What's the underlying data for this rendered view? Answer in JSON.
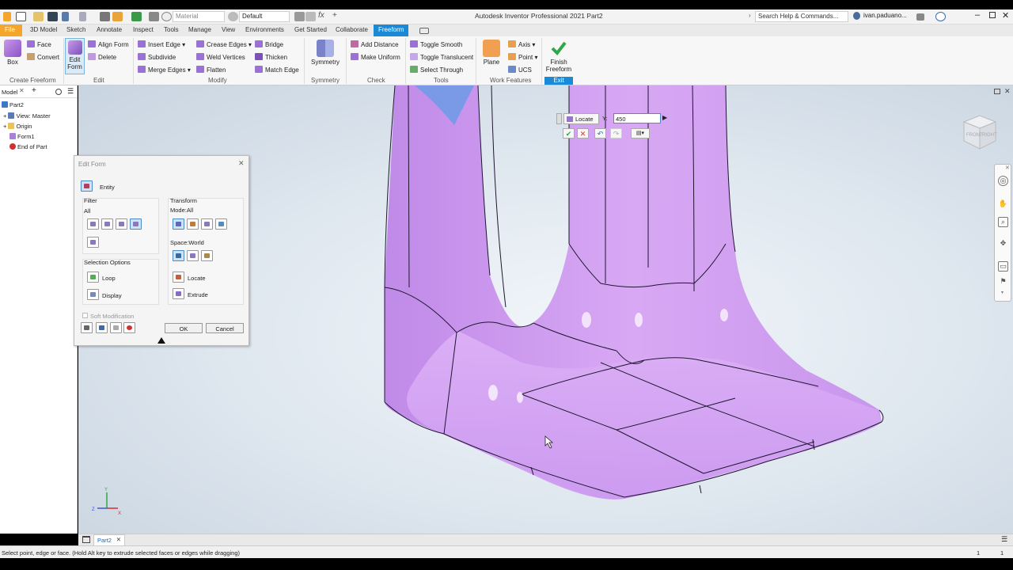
{
  "app": {
    "title": "Autodesk Inventor Professional 2021   Part2"
  },
  "quick_access": {
    "material": "Material",
    "appearance": "Default",
    "fx": "fx"
  },
  "help": {
    "search": "Search Help & Commands...",
    "user": "ivan.paduano..."
  },
  "tabs": [
    "File",
    "3D Model",
    "Sketch",
    "Annotate",
    "Inspect",
    "Tools",
    "Manage",
    "View",
    "Environments",
    "Get Started",
    "Collaborate",
    "Freeform"
  ],
  "ribbon": {
    "create_freeform": {
      "label": "Create Freeform",
      "box": "Box",
      "face": "Face",
      "convert": "Convert"
    },
    "edit": {
      "label": "Edit",
      "edit_form": "Edit Form",
      "align_form": "Align Form",
      "delete": "Delete"
    },
    "modify": {
      "label": "Modify",
      "insert_edge": "Insert Edge",
      "subdivide": "Subdivide",
      "merge_edges": "Merge Edges",
      "crease_edges": "Crease Edges",
      "weld_vertices": "Weld Vertices",
      "flatten": "Flatten",
      "bridge": "Bridge",
      "thicken": "Thicken",
      "match_edge": "Match Edge"
    },
    "symmetry": {
      "label": "Symmetry",
      "button": "Symmetry"
    },
    "check": {
      "label": "Check",
      "add_distance": "Add Distance",
      "make_uniform": "Make Uniform"
    },
    "tools": {
      "label": "Tools",
      "toggle_smooth": "Toggle Smooth",
      "toggle_translucent": "Toggle Translucent",
      "select_through": "Select Through"
    },
    "work_features": {
      "label": "Work Features",
      "plane": "Plane",
      "axis": "Axis",
      "point": "Point",
      "ucs": "UCS"
    },
    "exit": {
      "label": "Exit",
      "finish": "Finish Freeform"
    }
  },
  "browser": {
    "header": "Model",
    "items": [
      "Part2",
      "View: Master",
      "Origin",
      "Form1",
      "End of Part"
    ]
  },
  "dialog": {
    "title": "Edit Form",
    "entity": "Entity",
    "filter": "Filter",
    "filter_value": "All",
    "transform": "Transform",
    "mode": "Mode:All",
    "space": "Space:World",
    "selection_options": "Selection Options",
    "loop": "Loop",
    "display": "Display",
    "locate": "Locate",
    "extrude": "Extrude",
    "soft_modification": "Soft Modification",
    "ok": "OK",
    "cancel": "Cancel"
  },
  "minitoolbar": {
    "mode": "Locate",
    "axis": "Y:",
    "value": "450"
  },
  "viewcube": {
    "front": "FRONT",
    "right": "RIGHT"
  },
  "doc_tab": "Part2",
  "status": {
    "message": "Select point, edge or face. (Hold Alt key to extrude selected faces or edges while dragging)",
    "n1": "1",
    "n2": "1"
  },
  "colors": {
    "accent": "#1a8ad6",
    "file_tab": "#f3a62a",
    "form": "#d7a8f3",
    "form_edge": "#1a1a1a"
  }
}
